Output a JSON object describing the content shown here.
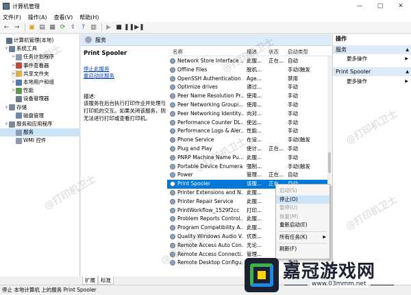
{
  "window": {
    "title": "计算机管理",
    "minimize": "—",
    "maximize": "□",
    "close": "✕"
  },
  "menubar": [
    "文件(F)",
    "操作(A)",
    "查看(V)",
    "帮助(H)"
  ],
  "toolbar": {
    "icons": [
      "back-arrow-icon",
      "forward-arrow-icon",
      "folder-up-icon",
      "show-tree-icon",
      "properties-icon",
      "refresh-icon",
      "export-icon",
      "help-icon",
      "show-hide-icon",
      "play-icon",
      "stop-icon",
      "pause-icon",
      "restart-icon"
    ]
  },
  "tree": {
    "items": [
      {
        "label": "计算机管理(本地)",
        "level": 0,
        "arrow": "",
        "icon_color": "#5b6f87"
      },
      {
        "label": "系统工具",
        "level": 1,
        "arrow": "∨",
        "icon_color": "#6b7f95"
      },
      {
        "label": "任务计划程序",
        "level": 2,
        "arrow": ">",
        "icon_color": "#8a9bb0"
      },
      {
        "label": "事件查看器",
        "level": 2,
        "arrow": ">",
        "icon_color": "#c04a3a"
      },
      {
        "label": "共享文件夹",
        "level": 2,
        "arrow": ">",
        "icon_color": "#e2b84a"
      },
      {
        "label": "本地用户和组",
        "level": 2,
        "arrow": ">",
        "icon_color": "#4f7ab8"
      },
      {
        "label": "性能",
        "level": 2,
        "arrow": ">",
        "icon_color": "#5a9a4a"
      },
      {
        "label": "设备管理器",
        "level": 2,
        "arrow": "",
        "icon_color": "#6a7a8a"
      },
      {
        "label": "存储",
        "level": 1,
        "arrow": "∨",
        "icon_color": "#7a8a9a"
      },
      {
        "label": "磁盘管理",
        "level": 2,
        "arrow": "",
        "icon_color": "#6a8aaa"
      },
      {
        "label": "服务和应用程序",
        "level": 1,
        "arrow": "∨",
        "icon_color": "#7a8a9a"
      },
      {
        "label": "服务",
        "level": 2,
        "arrow": "",
        "icon_color": "#8a9ab0",
        "selected": true
      },
      {
        "label": "WMI 控件",
        "level": 2,
        "arrow": "",
        "icon_color": "#8a9ab0"
      }
    ]
  },
  "center": {
    "header_title": "服务",
    "service_title": "Print Spooler",
    "link_stop": "停止此服务",
    "link_restart": "重启动此服务",
    "desc_label": "描述:",
    "desc_text": "该服务在后台执行打印作业并处理与打印机的交互。如果关闭该服务，则无法进行打印或查看打印机。"
  },
  "list": {
    "columns": {
      "name": "名称",
      "desc": "描述",
      "status": "状态",
      "start": "启动类型"
    },
    "rows": [
      {
        "name": "Network Store Interface ...",
        "desc": "此服...",
        "status": "正在...",
        "start": "自动"
      },
      {
        "name": "Offline Files",
        "desc": "脱机...",
        "status": "",
        "start": "手动(触发"
      },
      {
        "name": "OpenSSH Authentication ...",
        "desc": "Age...",
        "status": "",
        "start": "禁用"
      },
      {
        "name": "Optimize drives",
        "desc": "通过...",
        "status": "",
        "start": "手动"
      },
      {
        "name": "Peer Name Resolution Pr...",
        "desc": "使用...",
        "status": "",
        "start": "手动"
      },
      {
        "name": "Peer Networking Groupi...",
        "desc": "使用...",
        "status": "",
        "start": "手动"
      },
      {
        "name": "Peer Networking Identity...",
        "desc": "向对...",
        "status": "",
        "start": "手动"
      },
      {
        "name": "Performance Counter DL...",
        "desc": "使远...",
        "status": "",
        "start": "手动"
      },
      {
        "name": "Performance Logs & Aler...",
        "desc": "性能...",
        "status": "",
        "start": "手动"
      },
      {
        "name": "Phone Service",
        "desc": "在设...",
        "status": "",
        "start": "手动(触发"
      },
      {
        "name": "Plug and Play",
        "desc": "使计...",
        "status": "正在...",
        "start": "手动"
      },
      {
        "name": "PNRP Machine Name Pu...",
        "desc": "此服...",
        "status": "",
        "start": "手动"
      },
      {
        "name": "Portable Device Enumera...",
        "desc": "强制...",
        "status": "",
        "start": "手动(触发"
      },
      {
        "name": "Power",
        "desc": "管理...",
        "status": "正在...",
        "start": "自动"
      },
      {
        "name": "Print Spooler",
        "desc": "该服...",
        "status": "正在...",
        "start": "自动",
        "selected": true
      },
      {
        "name": "Printer Extensions and N...",
        "desc": "此服...",
        "status": "",
        "start": "手动"
      },
      {
        "name": "Printer Repair Service",
        "desc": "此服...",
        "status": "",
        "start": "自动"
      },
      {
        "name": "PrintWorkflow_1529f2cc",
        "desc": "打印...",
        "status": "",
        "start": "手动"
      },
      {
        "name": "Problem Reports Control...",
        "desc": "此服...",
        "status": "",
        "start": "手动"
      },
      {
        "name": "Program Compatibility A...",
        "desc": "此服...",
        "status": "",
        "start": "手动"
      },
      {
        "name": "Quality Windows Audio V...",
        "desc": "优质...",
        "status": "",
        "start": "手动"
      },
      {
        "name": "Remote Access Auto Con...",
        "desc": "无论...",
        "status": "",
        "start": "手动"
      },
      {
        "name": "Remote Access Connecti...",
        "desc": "管理...",
        "status": "",
        "start": "自动"
      },
      {
        "name": "Remote Desktop Configu...",
        "desc": "远程...",
        "status": "",
        "start": "手动"
      }
    ]
  },
  "tabs": [
    "扩展",
    "标准"
  ],
  "actions": {
    "title": "操作",
    "group1": "服务",
    "more1": "更多操作",
    "group2": "Print Spooler",
    "more2": "更多操作"
  },
  "context_menu": [
    {
      "label": "启动(S)",
      "state": "disabled"
    },
    {
      "label": "停止(O)",
      "state": "hover"
    },
    {
      "label": "暂停(U)",
      "state": "disabled"
    },
    {
      "label": "恢复(M)",
      "state": "disabled"
    },
    {
      "label": "重新启动(E)",
      "state": "normal"
    },
    {
      "sep": true
    },
    {
      "label": "所有任务(K)",
      "state": "normal",
      "submenu": true
    },
    {
      "sep": true
    },
    {
      "label": "刷新(F)",
      "state": "normal"
    }
  ],
  "statusbar": "停止 本地计算机 上的服务 Print Spooler",
  "watermark": "@打印机卫士",
  "logo": {
    "text": "嘉冠游戏网",
    "url": "www.03mmm.net"
  },
  "colors": {
    "selection": "#0078d7",
    "header_bg": "#ddeaf8",
    "link": "#0040c0"
  }
}
